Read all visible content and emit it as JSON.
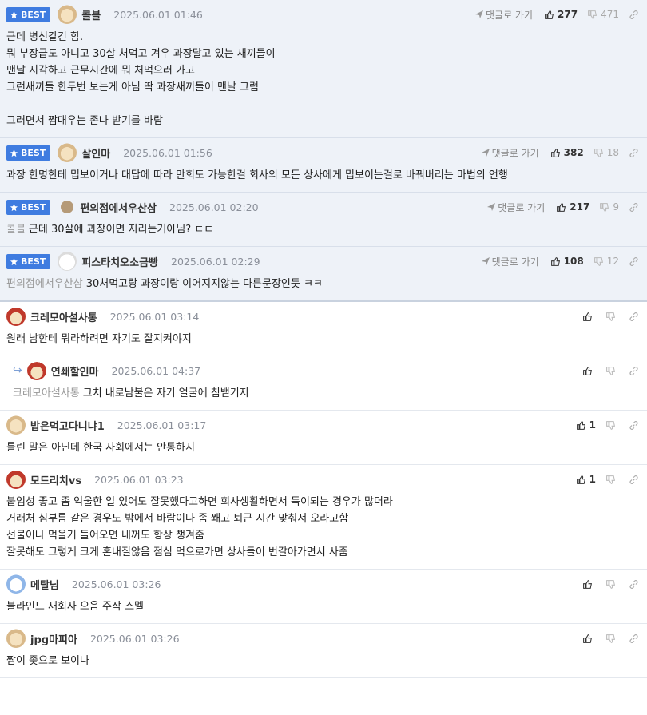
{
  "badge_label": "BEST",
  "reply_label": "댓글로 가기",
  "comments": [
    {
      "nick": "콜블",
      "date": "2025.06.01 01:46",
      "up": "277",
      "down": "471",
      "ref": "",
      "lines": "근데 병신같긴 함.\n뭐 부장급도 아니고 30살 처먹고 겨우 과장달고 있는 새끼들이\n맨날 지각하고 근무시간에 뭐 처먹으러 가고\n그런새끼들 한두번 보는게 아님 딱 과장새끼들이 맨날 그럼\n\n그러면서 짬대우는 존나 받기를 바람"
    },
    {
      "nick": "살인마",
      "date": "2025.06.01 01:56",
      "up": "382",
      "down": "18",
      "ref": "",
      "lines": "과장 한명한테 밉보이거나 대답에 따라 만회도 가능한걸 회사의 모든 상사에게 밉보이는걸로 바꿔버리는 마법의 언행"
    },
    {
      "nick": "편의점에서우산삼",
      "date": "2025.06.01 02:20",
      "up": "217",
      "down": "9",
      "ref": "콜블",
      "lines": "근데 30살에 과장이면 지리는거아님? ㄷㄷ"
    },
    {
      "nick": "피스타치오소금빵",
      "date": "2025.06.01 02:29",
      "up": "108",
      "down": "12",
      "ref": "편의점에서우산삼",
      "lines": "30처먹고랑 과장이랑 이어지지않는 다른문장인듯 ㅋㅋ"
    },
    {
      "nick": "크레모아설사통",
      "date": "2025.06.01 03:14",
      "up": "",
      "down": "",
      "ref": "",
      "lines": "원래 남한테 뭐라하려면 자기도 잘지켜야지"
    },
    {
      "nick": "연쇄할인마",
      "date": "2025.06.01 04:37",
      "up": "",
      "down": "",
      "ref": "크레모아설사통",
      "lines": "그치 내로남불은 자기 얼굴에 침뱉기지"
    },
    {
      "nick": "밥은먹고다니냐1",
      "date": "2025.06.01 03:17",
      "up": "1",
      "down": "",
      "ref": "",
      "lines": "틀린 말은 아닌데 한국 사회에서는 안통하지"
    },
    {
      "nick": "모드리치vs",
      "date": "2025.06.01 03:23",
      "up": "1",
      "down": "",
      "ref": "",
      "lines": "붙임성 좋고 좀 억울한 일 있어도 잘못했다고하면 회사생활하면서 득이되는 경우가 많더라\n거래처 심부름 같은 경우도 밖에서 바람이나 좀 쐐고 퇴근 시간 맞춰서 오라고함\n선물이나 먹을거 들어오면 내꺼도 항상 챙겨줌\n잘못해도 그렇게 크게 혼내질않음 점심 먹으로가면 상사들이 번갈아가면서 사줌"
    },
    {
      "nick": "메탈님",
      "date": "2025.06.01 03:26",
      "up": "",
      "down": "",
      "ref": "",
      "lines": "블라인드 새회사 으음 주작 스멜"
    },
    {
      "nick": "jpg마피아",
      "date": "2025.06.01 03:26",
      "up": "",
      "down": "",
      "ref": "",
      "lines": "짬이 좆으로 보이나"
    }
  ]
}
